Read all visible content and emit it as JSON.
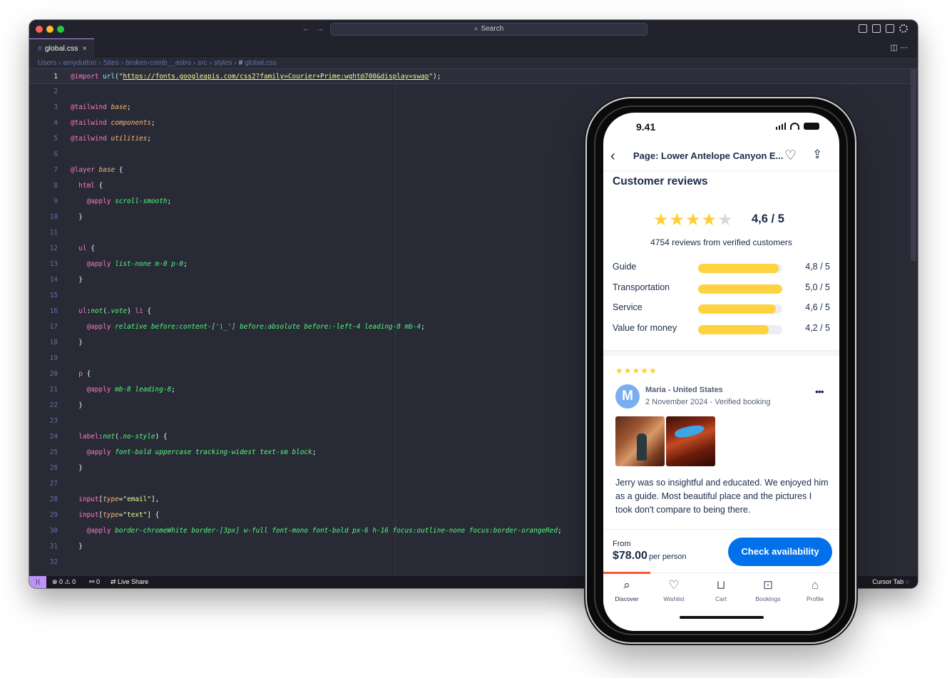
{
  "editor": {
    "search_label": "Search",
    "tab": {
      "name": "global.css",
      "close": "×"
    },
    "breadcrumb": [
      "Users",
      "amydutton",
      "Sites",
      "broken-comb__astro",
      "src",
      "styles"
    ],
    "breadcrumb_file": "global.css",
    "status": {
      "errors": "0",
      "warnings": "0",
      "ports": "0",
      "live_share": "Live Share",
      "cursor_tab": "Cursor Tab"
    },
    "line_numbers": [
      "1",
      "2",
      "3",
      "4",
      "5",
      "6",
      "7",
      "8",
      "9",
      "10",
      "11",
      "12",
      "13",
      "14",
      "15",
      "16",
      "17",
      "18",
      "19",
      "20",
      "21",
      "22",
      "23",
      "24",
      "25",
      "26",
      "27",
      "28",
      "29",
      "30",
      "31",
      "32"
    ]
  },
  "phone": {
    "status_time": "9.41",
    "header_title": "Page: Lower Antelope Canyon E...",
    "section_title": "Customer reviews",
    "overall_score": "4,6 / 5",
    "overall_rating": 4.6,
    "review_count_text": "4754 reviews from verified customers",
    "ratings": [
      {
        "label": "Guide",
        "value": "4,8 / 5",
        "score": 4.8
      },
      {
        "label": "Transportation",
        "value": "5,0 / 5",
        "score": 5.0
      },
      {
        "label": "Service",
        "value": "4,6 / 5",
        "score": 4.6
      },
      {
        "label": "Value for money",
        "value": "4,2 / 5",
        "score": 4.2
      }
    ],
    "review": {
      "stars": "★★★★★",
      "avatar_letter": "M",
      "reviewer": "Maria - United States",
      "meta": "2 November 2024 - Verified booking",
      "text": "Jerry was so insightful and educated. We enjoyed him as a guide. Most beautiful place and the pictures I took don't compare to being there."
    },
    "price": {
      "from": "From",
      "amount": "$78.00",
      "per": "per person"
    },
    "cta": "Check availability",
    "tabs": [
      {
        "label": "Discover",
        "icon": "search-icon"
      },
      {
        "label": "Wishlist",
        "icon": "heart-icon"
      },
      {
        "label": "Cart",
        "icon": "cart-icon"
      },
      {
        "label": "Bookings",
        "icon": "bookings-icon"
      },
      {
        "label": "Profile",
        "icon": "profile-icon"
      }
    ]
  },
  "colors": {
    "editor_bg": "#282a36",
    "accent": "#bd93f9",
    "cta_blue": "#0071eb",
    "star_yellow": "#ffcc33",
    "bar_yellow": "#ffd23f",
    "active_tab": "#ff5533"
  }
}
